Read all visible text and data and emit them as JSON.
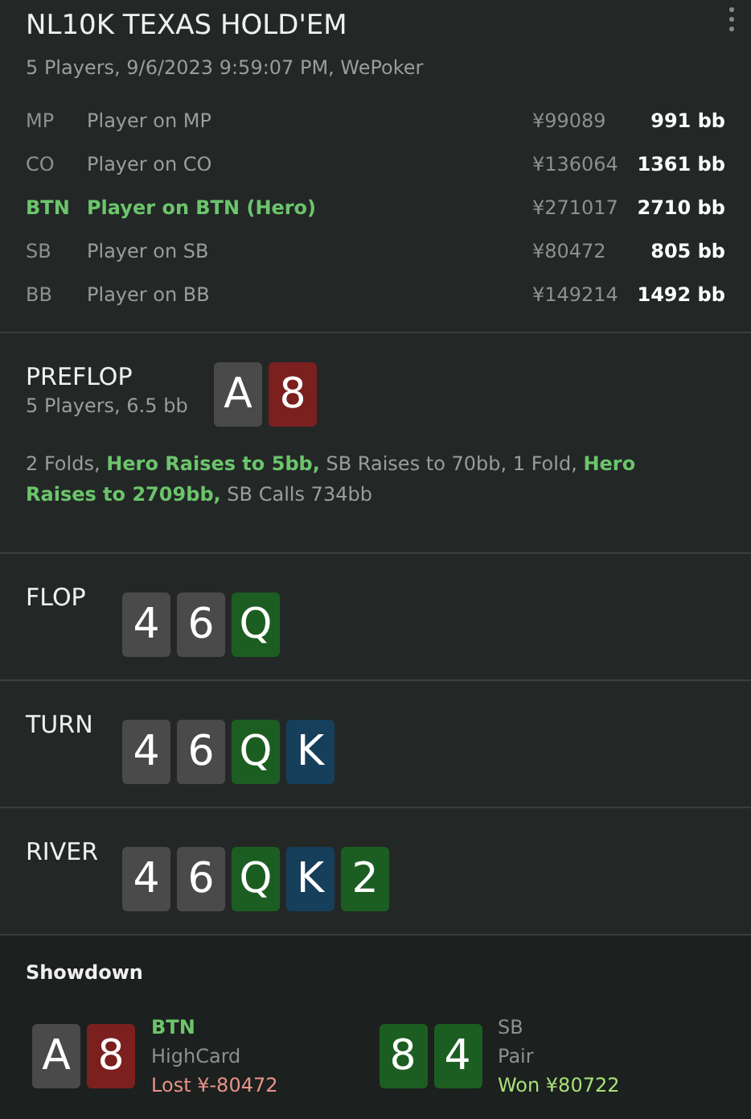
{
  "header": {
    "title": "NL10K TEXAS HOLD'EM",
    "subtitle": "5 Players, 9/6/2023 9:59:07 PM, WePoker"
  },
  "players": [
    {
      "position": "MP",
      "name": "Player on MP",
      "chips": "¥99089",
      "stack": "991 bb",
      "hero": false
    },
    {
      "position": "CO",
      "name": "Player on CO",
      "chips": "¥136064",
      "stack": "1361 bb",
      "hero": false
    },
    {
      "position": "BTN",
      "name": "Player on BTN (Hero)",
      "chips": "¥271017",
      "stack": "2710 bb",
      "hero": true
    },
    {
      "position": "SB",
      "name": "Player on SB",
      "chips": "¥80472",
      "stack": "805 bb",
      "hero": false
    },
    {
      "position": "BB",
      "name": "Player on BB",
      "chips": "¥149214",
      "stack": "1492 bb",
      "hero": false
    }
  ],
  "streets": [
    {
      "name": "PREFLOP",
      "info": "5 Players, 6.5 bb",
      "actions": "2 Folds, **Hero Raises to 5bb,** SB Raises to 70bb, 1 Fold, **Hero Raises to 2709bb,** SB Calls 734bb",
      "cards": [
        {
          "rank": "A",
          "color": "#4a4a4a"
        },
        {
          "rank": "8",
          "color": "#7b1f1f"
        }
      ]
    },
    {
      "name": "FLOP",
      "cards": [
        {
          "rank": "4",
          "color": "#4a4a4a"
        },
        {
          "rank": "6",
          "color": "#4a4a4a"
        },
        {
          "rank": "Q",
          "color": "#1c5e22"
        }
      ]
    },
    {
      "name": "TURN",
      "cards": [
        {
          "rank": "4",
          "color": "#4a4a4a"
        },
        {
          "rank": "6",
          "color": "#4a4a4a"
        },
        {
          "rank": "Q",
          "color": "#1c5e22"
        },
        {
          "rank": "K",
          "color": "#163f5c"
        }
      ]
    },
    {
      "name": "RIVER",
      "cards": [
        {
          "rank": "4",
          "color": "#4a4a4a"
        },
        {
          "rank": "6",
          "color": "#4a4a4a"
        },
        {
          "rank": "Q",
          "color": "#1c5e22"
        },
        {
          "rank": "K",
          "color": "#163f5c"
        },
        {
          "rank": "2",
          "color": "#1c5e22"
        }
      ]
    }
  ],
  "showdown": {
    "title": "Showdown",
    "hands": [
      {
        "position": "BTN",
        "hero": true,
        "hand": "HighCard",
        "result": "Lost ¥-80472",
        "won": false,
        "cards": [
          {
            "rank": "A",
            "color": "#4a4a4a"
          },
          {
            "rank": "8",
            "color": "#7b1f1f"
          }
        ]
      },
      {
        "position": "SB",
        "hero": false,
        "hand": "Pair",
        "result": "Won ¥80722",
        "won": true,
        "cards": [
          {
            "rank": "8",
            "color": "#1c5e22"
          },
          {
            "rank": "4",
            "color": "#1c5e22"
          }
        ]
      }
    ]
  }
}
